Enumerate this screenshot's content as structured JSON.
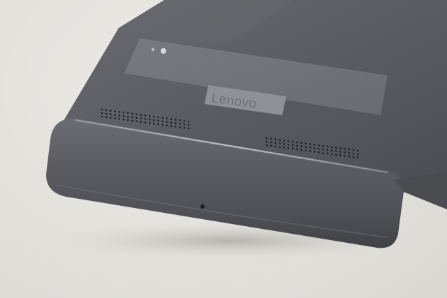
{
  "photo": {
    "subject": "phone-back-bottom",
    "brand_logo": {
      "text": "Lenovo",
      "color": "#6e7076"
    },
    "colors": {
      "background": "#e4e3de",
      "body": "#5c5e63",
      "body_dark": "#46484c",
      "chin": "#55575c",
      "logo_plate": "#8f9196"
    },
    "icon_names": [
      "speaker-grille-icon",
      "microphone-hole-icon",
      "flash-icon"
    ]
  }
}
